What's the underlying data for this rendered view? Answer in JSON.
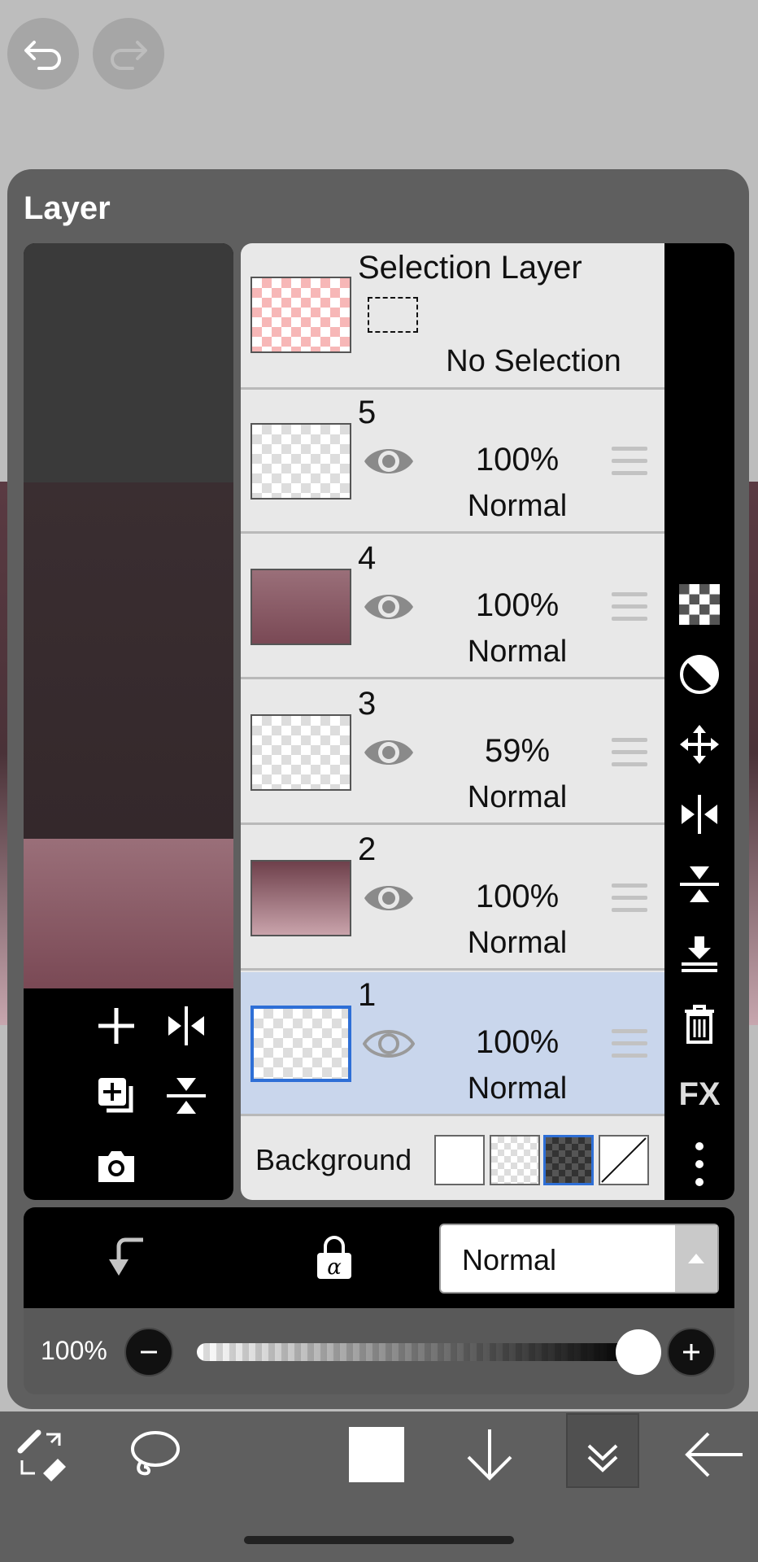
{
  "panel": {
    "title": "Layer"
  },
  "selection_layer": {
    "title": "Selection Layer",
    "status": "No Selection"
  },
  "layers": [
    {
      "num": "5",
      "opacity": "100%",
      "mode": "Normal"
    },
    {
      "num": "4",
      "opacity": "100%",
      "mode": "Normal"
    },
    {
      "num": "3",
      "opacity": "59%",
      "mode": "Normal"
    },
    {
      "num": "2",
      "opacity": "100%",
      "mode": "Normal"
    },
    {
      "num": "1",
      "opacity": "100%",
      "mode": "Normal"
    }
  ],
  "background": {
    "label": "Background"
  },
  "blend": {
    "selected": "Normal"
  },
  "opacity": {
    "label": "100%",
    "value": 1.0
  },
  "sidebar_fx": "FX",
  "colors": {
    "accent": "#2e6fd6",
    "selected_row": "#c9d6ec",
    "panel": "#5f5f5f"
  }
}
